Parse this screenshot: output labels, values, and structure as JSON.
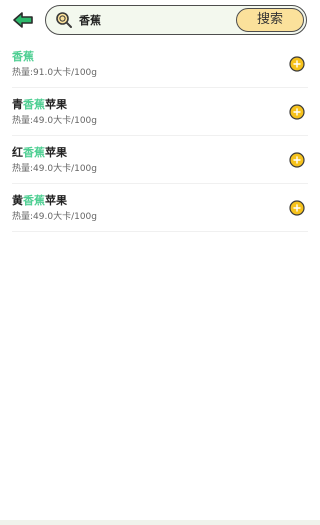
{
  "header": {
    "search": {
      "value": "香蕉",
      "button_label": "搜索"
    }
  },
  "results": [
    {
      "prefix": "",
      "match": "香蕉",
      "suffix": "",
      "calories": "热量:91.0大卡/100g"
    },
    {
      "prefix": "青",
      "match": "香蕉",
      "suffix": "苹果",
      "calories": "热量:49.0大卡/100g"
    },
    {
      "prefix": "红",
      "match": "香蕉",
      "suffix": "苹果",
      "calories": "热量:49.0大卡/100g"
    },
    {
      "prefix": "黄",
      "match": "香蕉",
      "suffix": "苹果",
      "calories": "热量:49.0大卡/100g"
    }
  ],
  "colors": {
    "accent_green": "#4fcf93",
    "arrow_green": "#2db86b",
    "button_yellow": "#fbe19b",
    "add_yellow": "#f6c21c"
  },
  "icons": {
    "back": "arrow-left-icon",
    "search": "search-icon",
    "add": "plus-circle-icon"
  }
}
